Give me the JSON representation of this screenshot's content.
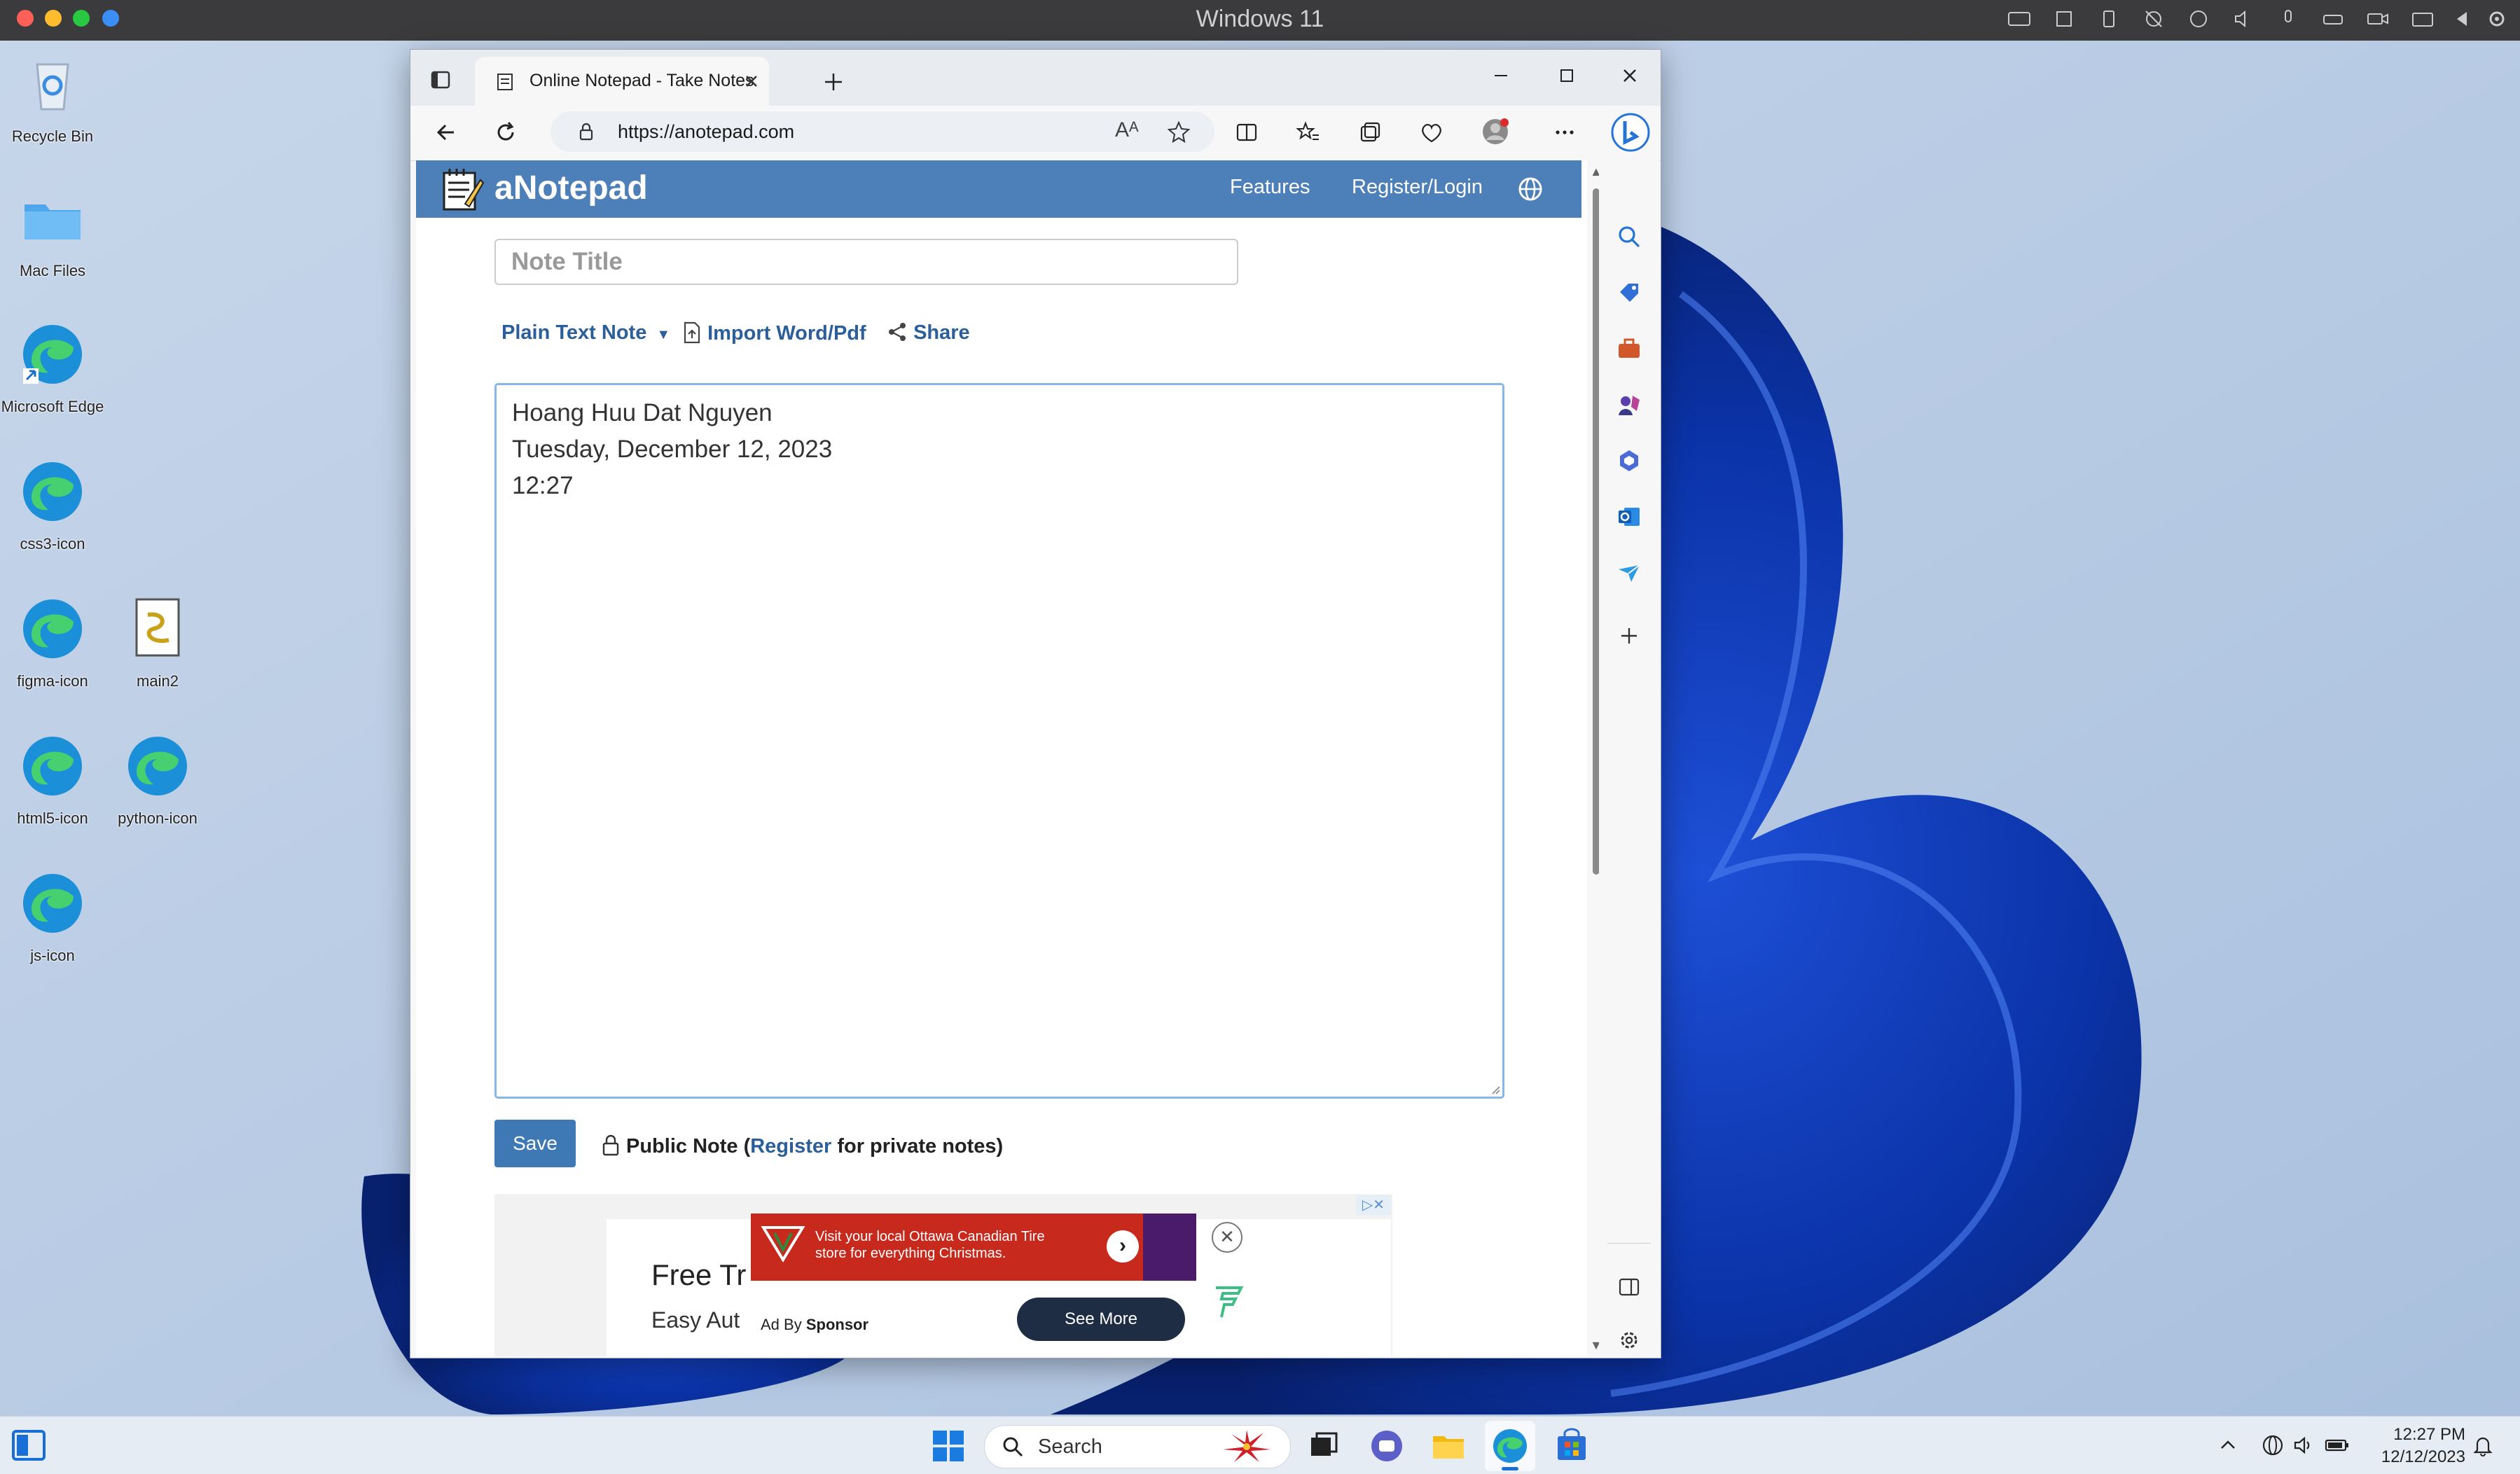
{
  "mac": {
    "title": "Windows 11"
  },
  "desktop": {
    "icons": [
      {
        "label": "Recycle Bin"
      },
      {
        "label": "Mac Files"
      },
      {
        "label": "Microsoft Edge"
      },
      {
        "label": "css3-icon"
      },
      {
        "label": "figma-icon"
      },
      {
        "label": "main2"
      },
      {
        "label": "html5-icon"
      },
      {
        "label": "python-icon"
      },
      {
        "label": "js-icon"
      }
    ]
  },
  "browser": {
    "tab_title": "Online Notepad - Take Notes and",
    "url": "https://anotepad.com",
    "read_aloud": "A̅"
  },
  "site": {
    "logo": "aNotepad",
    "nav": {
      "features": "Features",
      "register_login": "Register/Login"
    },
    "title_placeholder": "Note Title",
    "toolbar": {
      "note_type": "Plain Text Note",
      "import": "Import Word/Pdf",
      "share": "Share"
    },
    "note_lines": [
      "Hoang Huu Dat Nguyen",
      "Tuesday, December 12, 2023",
      "12:27"
    ],
    "save": "Save",
    "public_note": {
      "prefix": "Public Note (",
      "link": "Register",
      "suffix": " for private notes)"
    },
    "ad": {
      "headline_partial": "Free Tr",
      "sub_partial": "Easy Aut",
      "banner_text_1": "Visit your local Ottawa Canadian Tire",
      "banner_text_2": "store for everything Christmas.",
      "ad_by": "Ad By",
      "sponsor": "Sponsor",
      "cta": "See More"
    }
  },
  "taskbar": {
    "search": "Search",
    "time": "12:27 PM",
    "date": "12/12/2023"
  },
  "colors": {
    "site_header": "#4d7fb8",
    "link": "#2c5f99",
    "save_button": "#3e78b5",
    "ad_red": "#c8291d"
  }
}
